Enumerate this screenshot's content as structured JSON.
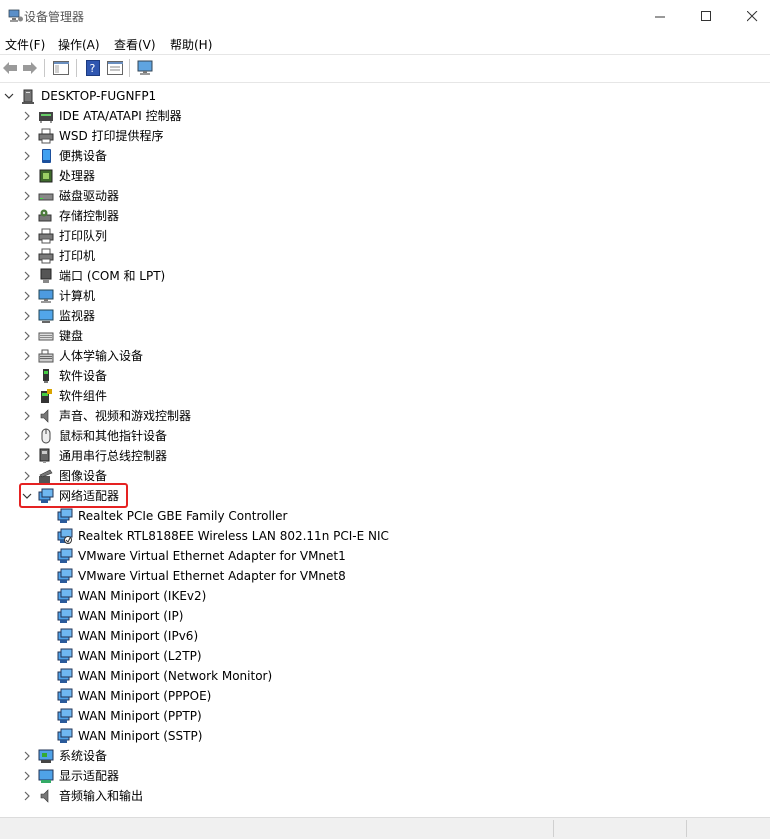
{
  "window": {
    "title": "设备管理器"
  },
  "menu": [
    "文件(F)",
    "操作(A)",
    "查看(V)",
    "帮助(H)"
  ],
  "tree": {
    "root": "DESKTOP-FUGNFP1",
    "categories": [
      {
        "label": "IDE ATA/ATAPI 控制器",
        "icon": "ide-controller-icon"
      },
      {
        "label": "WSD 打印提供程序",
        "icon": "printer-icon"
      },
      {
        "label": "便携设备",
        "icon": "portable-device-icon"
      },
      {
        "label": "处理器",
        "icon": "processor-icon"
      },
      {
        "label": "磁盘驱动器",
        "icon": "disk-drive-icon"
      },
      {
        "label": "存储控制器",
        "icon": "storage-controller-icon"
      },
      {
        "label": "打印队列",
        "icon": "printer-icon"
      },
      {
        "label": "打印机",
        "icon": "printer-icon"
      },
      {
        "label": "端口 (COM 和 LPT)",
        "icon": "port-icon"
      },
      {
        "label": "计算机",
        "icon": "computer-icon"
      },
      {
        "label": "监视器",
        "icon": "monitor-icon"
      },
      {
        "label": "键盘",
        "icon": "keyboard-icon"
      },
      {
        "label": "人体学输入设备",
        "icon": "hid-icon"
      },
      {
        "label": "软件设备",
        "icon": "software-device-icon"
      },
      {
        "label": "软件组件",
        "icon": "software-component-icon"
      },
      {
        "label": "声音、视频和游戏控制器",
        "icon": "speaker-icon"
      },
      {
        "label": "鼠标和其他指针设备",
        "icon": "mouse-icon"
      },
      {
        "label": "通用串行总线控制器",
        "icon": "usb-icon"
      },
      {
        "label": "图像设备",
        "icon": "camera-icon"
      },
      {
        "label": "网络适配器",
        "icon": "network-adapter-icon",
        "expanded": true,
        "children": [
          "Realtek PCIe GBE Family Controller",
          "Realtek RTL8188EE Wireless LAN 802.11n PCI-E NIC",
          "VMware Virtual Ethernet Adapter for VMnet1",
          "VMware Virtual Ethernet Adapter for VMnet8",
          "WAN Miniport (IKEv2)",
          "WAN Miniport (IP)",
          "WAN Miniport (IPv6)",
          "WAN Miniport (L2TP)",
          "WAN Miniport (Network Monitor)",
          "WAN Miniport (PPPOE)",
          "WAN Miniport (PPTP)",
          "WAN Miniport (SSTP)"
        ]
      },
      {
        "label": "系统设备",
        "icon": "system-device-icon"
      },
      {
        "label": "显示适配器",
        "icon": "display-adapter-icon"
      },
      {
        "label": "音频输入和输出",
        "icon": "audio-io-icon"
      }
    ]
  },
  "colors": {
    "highlight": "#e52222",
    "accent": "#1e90d6"
  }
}
